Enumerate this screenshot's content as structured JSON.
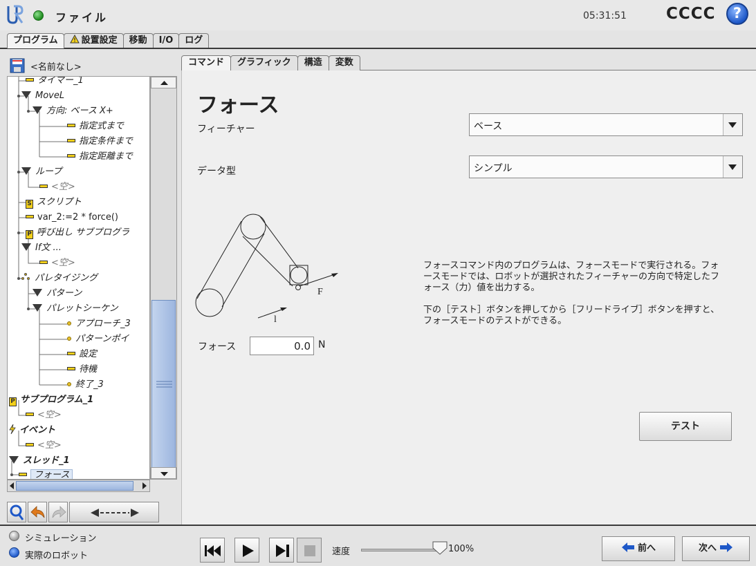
{
  "header": {
    "file_label": "ファイル",
    "clock": "05:31:51",
    "robot_name": "CCCC",
    "help_symbol": "?"
  },
  "main_tabs": [
    "プログラム",
    "設置設定",
    "移動",
    "I/O",
    "ログ"
  ],
  "program": {
    "name": "<名前なし>"
  },
  "tree": [
    {
      "label": "タイマー_1"
    },
    {
      "label": "MoveL"
    },
    {
      "label": "方向: ベース X+"
    },
    {
      "label": "指定式まで"
    },
    {
      "label": "指定条件まで"
    },
    {
      "label": "指定距離まで"
    },
    {
      "label": "ループ"
    },
    {
      "label": "<空>"
    },
    {
      "label": "スクリプト"
    },
    {
      "label": "var_2:=2 * force()"
    },
    {
      "label": "呼び出し サブプログラ"
    },
    {
      "label": "If文 ..."
    },
    {
      "label": "<空>"
    },
    {
      "label": "パレタイジング"
    },
    {
      "label": "パターン"
    },
    {
      "label": "パレットシーケン"
    },
    {
      "label": "アプローチ_3"
    },
    {
      "label": "パターンポイ"
    },
    {
      "label": "設定"
    },
    {
      "label": "待機"
    },
    {
      "label": "終了_3"
    },
    {
      "label": "サブプログラム_1"
    },
    {
      "label": "<空>"
    },
    {
      "label": "イベント"
    },
    {
      "label": "<空>"
    },
    {
      "label": "スレッド_1"
    },
    {
      "label": "フォース"
    }
  ],
  "sub_tabs": [
    "コマンド",
    "グラフィック",
    "構造",
    "変数"
  ],
  "force_panel": {
    "title": "フォース",
    "feature_label": "フィーチャー",
    "feature_value": "ベース",
    "data_type_label": "データ型",
    "data_type_value": "シンプル",
    "force_label": "フォース",
    "force_value": "0.0",
    "force_unit": "N",
    "diagram_f": "F",
    "diagram_l": "l",
    "description_1": "フォースコマンド内のプログラムは、フォースモードで実行される。フォースモードでは、ロボットが選択されたフィーチャーの方向で特定したフォース（力）値を出力する。",
    "description_2": "下の［テスト］ボタンを押してから［フリードライブ］ボタンを押すと、フォースモードのテストができる。",
    "test_button": "テスト"
  },
  "footer": {
    "simulation_label": "シミュレーション",
    "real_robot_label": "実際のロボット",
    "speed_label": "速度",
    "speed_value": "100%",
    "speed_fraction": 1.0,
    "prev_label": "前へ",
    "next_label": "次へ"
  },
  "colors": {
    "accent_blue": "#1e58c8",
    "status_green": "#1d8a1d",
    "icon_yellow": "#f2cf1a",
    "selection": "#dfe9f7"
  }
}
